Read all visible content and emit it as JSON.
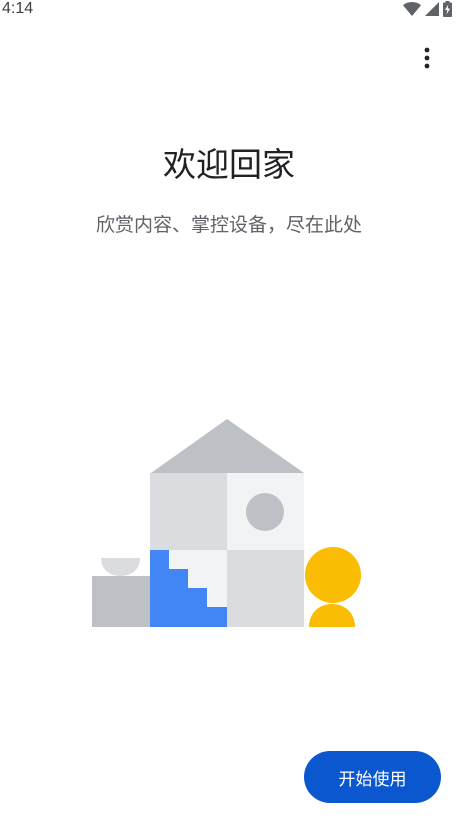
{
  "status_bar": {
    "time": "4:14",
    "icons": [
      "wifi-icon",
      "cellular-signal-icon",
      "battery-charging-icon"
    ]
  },
  "toolbar": {
    "overflow_icon": "more-vertical-icon"
  },
  "welcome": {
    "title": "欢迎回家",
    "subtitle": "欣赏内容、掌控设备，尽在此处"
  },
  "illustration": {
    "name": "house-illustration",
    "colors": {
      "roof": "#bdc1c6",
      "wall_light": "#dadce0",
      "wall_lighter": "#f1f3f4",
      "stairs": "#4285f4",
      "person": "#fbbc04",
      "window": "#bdc1c6"
    }
  },
  "actions": {
    "start_label": "开始使用"
  },
  "colors": {
    "primary": "#0b57d0",
    "text_primary": "#202124",
    "text_secondary": "#5f6368"
  }
}
